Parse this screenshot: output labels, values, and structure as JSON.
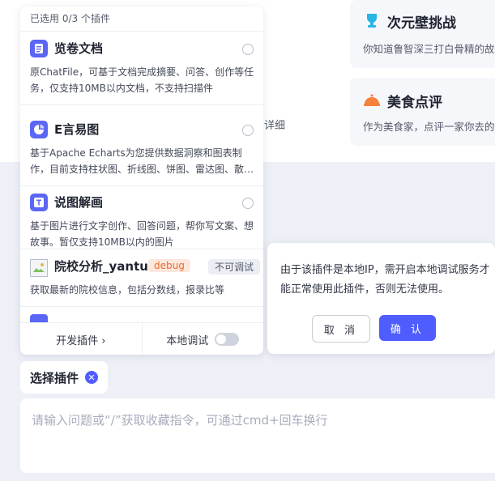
{
  "background": {
    "cards": [
      {
        "title": "次元壁挑战",
        "desc": "你知道鲁智深三打白骨精的故"
      },
      {
        "title": "美食点评",
        "desc": "作为美食家，点评一家你去的"
      }
    ],
    "partial_text": "详细"
  },
  "panel": {
    "header": "已选用 0/3 个插件",
    "plugins": [
      {
        "name": "览卷文档",
        "desc": "原ChatFile，可基于文档完成摘要、问答、创作等任务，仅支持10MB以内文档，不支持扫描件"
      },
      {
        "name": "E言易图",
        "desc": "基于Apache Echarts为您提供数据洞察和图表制作，目前支持柱状图、折线图、饼图、雷达图、散…"
      },
      {
        "name": "说图解画",
        "desc": "基于图片进行文字创作、回答问题，帮你写文案、想故事。暂仅支持10MB以内的图片"
      },
      {
        "name": "院校分析_yantu",
        "badge_debug": "debug",
        "badge_na": "不可调试",
        "desc": "获取最新的院校信息，包括分数线，报录比等"
      }
    ],
    "footer": {
      "dev_label": "开发插件 ›",
      "local_debug_label": "本地调试"
    }
  },
  "popup": {
    "message": "由于该插件是本地IP，需开启本地调试服务才能正常使用此插件，否则无法使用。",
    "cancel_label": "取 消",
    "confirm_label": "确 认"
  },
  "chip": {
    "label": "选择插件",
    "remove_glyph": "✕"
  },
  "input": {
    "placeholder": "请输入问题或“/”获取收藏指令，可通过cmd+回车换行"
  },
  "colors": {
    "accent": "#4f5dff",
    "debug": "#f06a2b"
  }
}
